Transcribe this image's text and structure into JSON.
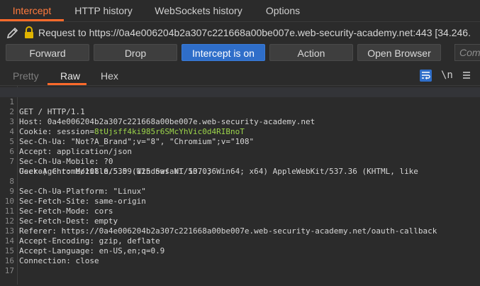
{
  "tabs": [
    {
      "label": "Intercept",
      "active": true
    },
    {
      "label": "HTTP history",
      "active": false
    },
    {
      "label": "WebSockets history",
      "active": false
    },
    {
      "label": "Options",
      "active": false
    }
  ],
  "request_bar": {
    "text": "Request to https://0a4e006204b2a307c221668a00be007e.web-security-academy.net:443  [34.246."
  },
  "buttons": {
    "forward": "Forward",
    "drop": "Drop",
    "intercept": "Intercept is on",
    "action": "Action",
    "open_browser": "Open Browser",
    "comment_placeholder": "Comment"
  },
  "view_tabs": {
    "pretty": "Pretty",
    "raw": "Raw",
    "hex": "Hex",
    "newline_toggle": "\\n"
  },
  "colors": {
    "accent_orange": "#ff6a2b",
    "primary_blue": "#2f6ec9",
    "cookie_value": "#9bd34a"
  },
  "request_lines": [
    {
      "n": "1",
      "text": "GET / HTTP/1.1"
    },
    {
      "n": "2",
      "key": "Host",
      "value": "0a4e006204b2a307c221668a00be007e.web-security-academy.net"
    },
    {
      "n": "3",
      "key": "Cookie",
      "cookie_name": "session",
      "cookie_value": "8tUjsff4ki985r6SMcYhVic0d4RIBnoT"
    },
    {
      "n": "4",
      "key": "Sec-Ch-Ua",
      "value": "\"Not?A_Brand\";v=\"8\", \"Chromium\";v=\"108\""
    },
    {
      "n": "5",
      "key": "Accept",
      "value": "application/json"
    },
    {
      "n": "6",
      "key": "Sec-Ch-Ua-Mobile",
      "value": "?0"
    },
    {
      "n": "7",
      "key": "User-Agent",
      "value": "Mozilla/5.0 (Windows NT 10.0; Win64; x64) AppleWebKit/537.36 (KHTML, like"
    },
    {
      "n": "",
      "text": "Gecko) Chrome/108.0.5359.125 Safari/537.36"
    },
    {
      "n": "8",
      "key": "Sec-Ch-Ua-Platform",
      "value": "\"Linux\""
    },
    {
      "n": "9",
      "key": "Sec-Fetch-Site",
      "value": "same-origin"
    },
    {
      "n": "10",
      "key": "Sec-Fetch-Mode",
      "value": "cors"
    },
    {
      "n": "11",
      "key": "Sec-Fetch-Dest",
      "value": "empty"
    },
    {
      "n": "12",
      "key": "Referer",
      "value": "https://0a4e006204b2a307c221668a00be007e.web-security-academy.net/oauth-callback"
    },
    {
      "n": "13",
      "key": "Accept-Encoding",
      "value": "gzip, deflate"
    },
    {
      "n": "14",
      "key": "Accept-Language",
      "value": "en-US,en;q=0.9"
    },
    {
      "n": "15",
      "key": "Connection",
      "value": "close"
    },
    {
      "n": "16",
      "text": ""
    },
    {
      "n": "17",
      "text": ""
    }
  ]
}
